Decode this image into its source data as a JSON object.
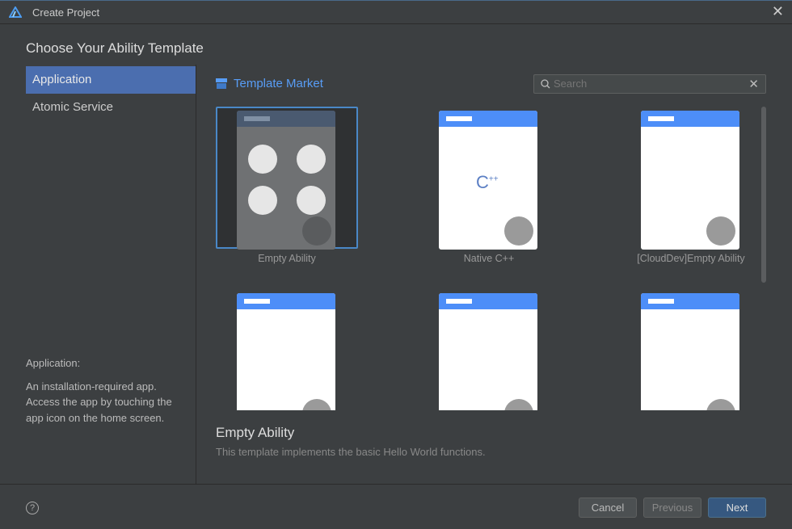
{
  "window": {
    "title": "Create Project"
  },
  "heading": "Choose Your Ability Template",
  "sidebar": {
    "items": [
      {
        "label": "Application",
        "selected": true
      },
      {
        "label": "Atomic Service",
        "selected": false
      }
    ],
    "description_title": "Application:",
    "description": "An installation-required app. Access the app by touching the app icon on the home screen."
  },
  "market": {
    "title": "Template Market",
    "search_placeholder": "Search"
  },
  "templates": [
    {
      "label": "Empty Ability"
    },
    {
      "label": "Native C++"
    },
    {
      "label": "[CloudDev]Empty Ability"
    },
    {
      "label": ""
    },
    {
      "label": ""
    },
    {
      "label": ""
    }
  ],
  "selected_template": {
    "title": "Empty Ability",
    "description": "This template implements the basic Hello World functions."
  },
  "footer": {
    "help": "?",
    "cancel": "Cancel",
    "previous": "Previous",
    "next": "Next"
  },
  "colors": {
    "accent": "#4b6eaf",
    "link": "#589df6",
    "thumb_bar": "#4d8ef8"
  }
}
